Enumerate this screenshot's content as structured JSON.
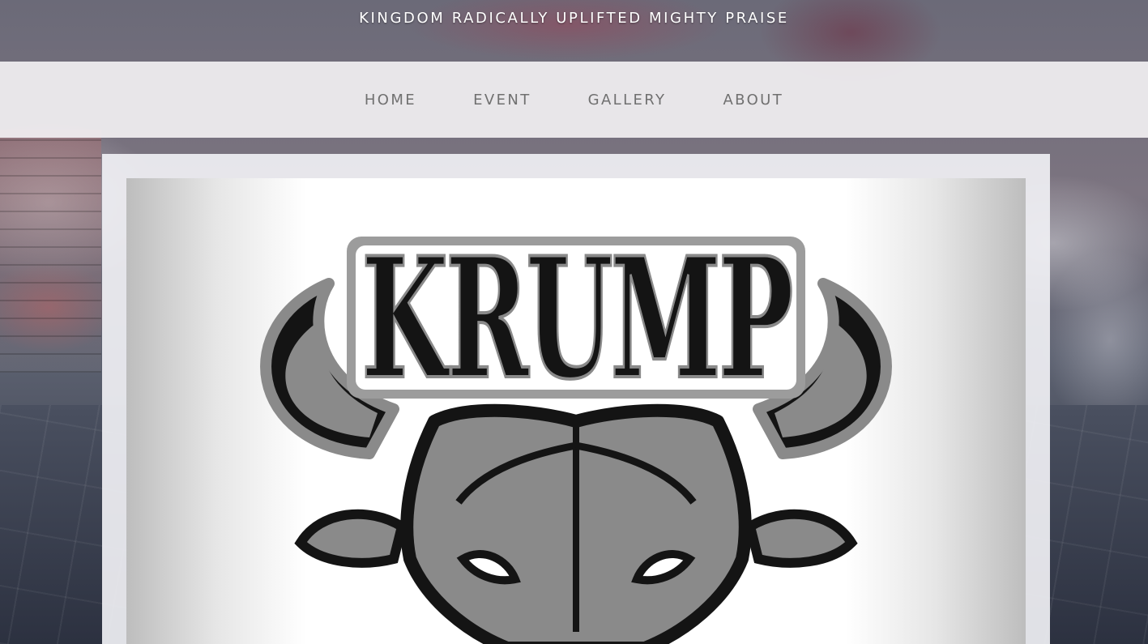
{
  "site": {
    "title": "KINGDOM RADICALLY UPLIFTED MIGHTY PRAISE"
  },
  "nav": {
    "items": [
      {
        "label": "HOME"
      },
      {
        "label": "EVENT"
      },
      {
        "label": "GALLERY"
      },
      {
        "label": "ABOUT"
      }
    ]
  },
  "hero": {
    "logo_text": "KRUMP",
    "logo_icon": "bull-head-icon"
  },
  "colors": {
    "nav_text": "#707070",
    "logo_dark": "#141414",
    "logo_gray": "#8a8a8a",
    "logo_light": "#9c9c9c"
  }
}
